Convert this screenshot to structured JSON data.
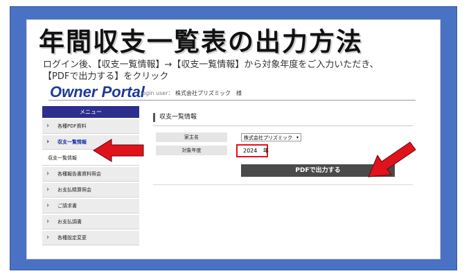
{
  "slide": {
    "title": "年間収支一覧表の出力方法",
    "instruction_line1": "ログイン後、【収支一覧情報】→【収支一覧情報】から対象年度をご入力いただき、",
    "instruction_line2": "【PDFで出力する】をクリック"
  },
  "header": {
    "logo": "Owner Portal",
    "login_label": "login user：",
    "login_user": "株式会社プリズミック　様"
  },
  "sidebar": {
    "menu_title": "メニュー",
    "items": [
      {
        "label": "各種PDF資料"
      },
      {
        "label": "収支一覧情報"
      },
      {
        "label": "収支一覧情報"
      },
      {
        "label": "各種報告書資料照会"
      },
      {
        "label": "お支払精算照会"
      },
      {
        "label": "ご請求書"
      },
      {
        "label": "お支払調書"
      },
      {
        "label": "各種設定変更"
      }
    ]
  },
  "main": {
    "section_title": "収支一覧情報",
    "owner_label": "家主名",
    "owner_value": "株式会社プリズミック",
    "year_label": "対象年度",
    "year_value": "2024",
    "year_suffix": "年",
    "pdf_button": "PDFで出力する"
  },
  "colors": {
    "frame": "#4a72c4",
    "menu_header": "#2d2f8f",
    "arrow": "#e0121b",
    "button": "#4a4a4a"
  }
}
